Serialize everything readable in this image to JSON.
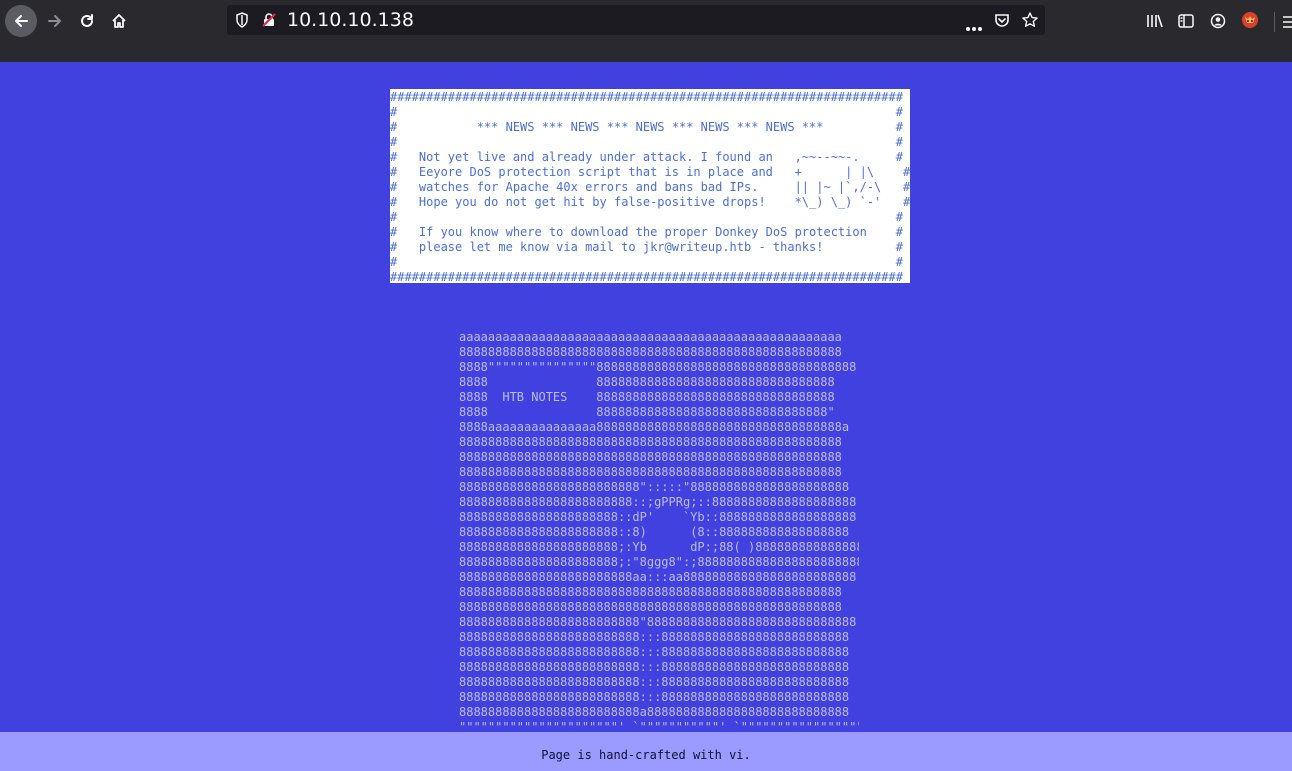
{
  "browser": {
    "url": "10.10.10.138",
    "icons": {
      "back": "back-arrow-icon",
      "forward": "forward-arrow-icon",
      "reload": "reload-icon",
      "home": "home-icon",
      "tracking": "shield-icon",
      "insecure": "insecure-lock-icon",
      "page_actions": "more-dots-icon",
      "pocket": "pocket-icon",
      "bookmark": "star-icon",
      "library": "library-icon",
      "sidebar": "sidebar-icon",
      "account": "account-icon",
      "extension": "fox-extension-icon",
      "menu": "hamburger-menu-icon"
    }
  },
  "news_box": {
    "text": "#######################################################################\n#                                                                     #\n#           *** NEWS *** NEWS *** NEWS *** NEWS *** NEWS ***          #\n#                                                                     #\n#   Not yet live and already under attack. I found an   ,~~--~~-.     #\n#   Eeyore DoS protection script that is in place and   +      | |\\    #\n#   watches for Apache 40x errors and bans bad IPs.     || |~ |`,/-\\   #\n#   Hope you do not get hit by false-positive drops!    *\\_) \\_) `-'   #\n#                                                                     #\n#   If you know where to download the proper Donkey DoS protection    #\n#   please let me know via mail to jkr@writeup.htb - thanks!          #\n#                                                                     #\n#######################################################################"
  },
  "ascii_art": {
    "text": "aaaaaaaaaaaaaaaaaaaaaaaaaaaaaaaaaaaaaaaaaaaaaaaaaaaaa\n88888888888888888888888888888888888888888888888888888\n8888\"\"\"\"\"\"\"\"\"\"\"\"\"\"\"888888888888888888888888888888888888\n8888               888888888888888888888888888888888\n8888  HTB NOTES    888888888888888888888888888888888\n8888               88888888888888888888888888888888\"\n8888aaaaaaaaaaaaaaa8888888888888888888888888888888888a\n88888888888888888888888888888888888888888888888888888\n88888888888888888888888888888888888888888888888888888\n88888888888888888888888888888888888888888888888888888\n8888888888888888888888888\":::::\"8888888888888888888888\n888888888888888888888888::;gPPRg;::88888888888888888888\n8888888888888888888888::dP'    `Yb::8888888888888888888\n8888888888888888888888::8)      (8::888888888888888888\n8888888888888888888888;:Yb      dP:;88( )888888888888888\n8888888888888888888888;:\"8ggg8\":;88888888888888888888888\n888888888888888888888888aa:::aa888888888888888888888888\n88888888888888888888888888888888888888888888888888888\n88888888888888888888888888888888888888888888888888888\n8888888888888888888888888\"88888888888888888888888888888\n8888888888888888888888888:::88888888888888888888888888\n8888888888888888888888888:::88888888888888888888888888\n8888888888888888888888888:::88888888888888888888888888\n8888888888888888888888888:::88888888888888888888888888\n8888888888888888888888888:::88888888888888888888888888\n8888888888888888888888888a8888888888888888888888888888\n\"\"\"\"\"\"\"\"\"\"\"\"\"\"\"\"\"\"\"\"\"\"' `\"\"\"\"\"\"\"\"\"\"\"' `\"\"\"\"\"\"\"\"\"\"\"\"\"\"\"\"\"\"\""
  },
  "footer": {
    "text": "Page is hand-crafted with vi."
  },
  "colors": {
    "page_bg": "#4141e0",
    "news_text": "#4a6fd8",
    "art_text": "#bcbcf6",
    "footer_bg": "#9a9aff",
    "chrome_bg": "#2a2a2e"
  }
}
